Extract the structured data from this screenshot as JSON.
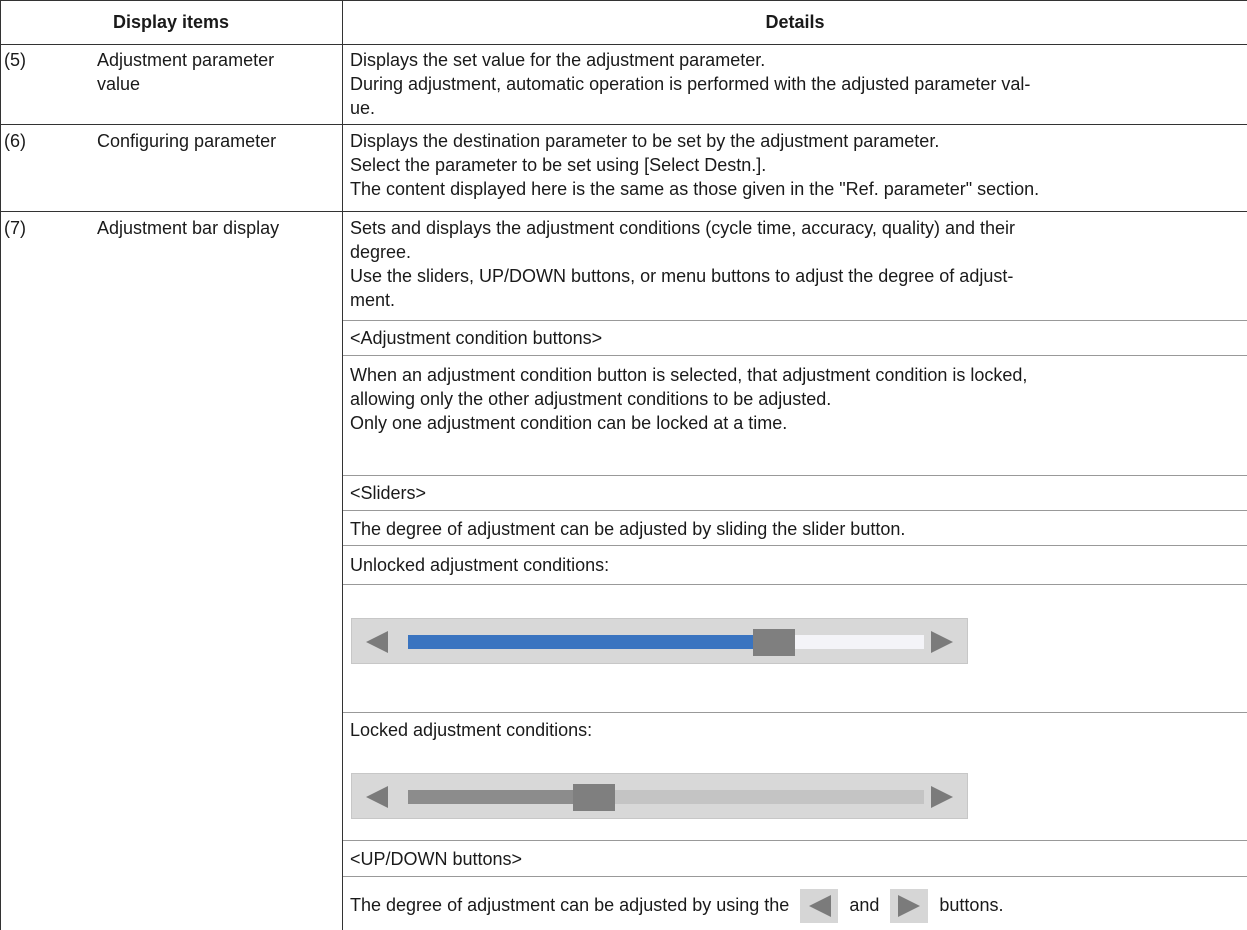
{
  "header": {
    "col1": "Display items",
    "col2": "Details"
  },
  "rows": [
    {
      "num": "(5)",
      "item": [
        "Adjustment parameter",
        "value"
      ],
      "details": [
        "Displays the set value for the adjustment parameter.",
        "During adjustment, automatic operation is performed with the adjusted parameter val-",
        "ue."
      ]
    },
    {
      "num": "(6)",
      "item": [
        "Configuring parameter"
      ],
      "details": [
        "Displays the destination parameter to be set by the adjustment parameter.",
        "Select the parameter to be set using [Select Destn.].",
        "The content displayed here is the same as those given in the \"Ref. parameter\" section."
      ]
    },
    {
      "num": "(7)",
      "item": [
        "Adjustment bar display"
      ],
      "intro": [
        "Sets and displays the adjustment conditions (cycle time, accuracy, quality) and their",
        "degree.",
        "Use the sliders, UP/DOWN buttons, or menu buttons to adjust the degree of adjust-",
        "ment."
      ],
      "cond_heading": "<Adjustment condition buttons>",
      "cond_text": [
        "When an adjustment condition button is selected, that adjustment condition is locked,",
        "allowing only the other adjustment conditions to be adjusted.",
        "Only one adjustment condition can be locked at a time."
      ],
      "sliders_heading": "<Sliders>",
      "sliders_text": "The degree of adjustment can be adjusted by sliding the slider button.",
      "unlocked_label": "Unlocked adjustment conditions:",
      "locked_label": "Locked adjustment conditions:",
      "updown_heading": "<UP/DOWN buttons>",
      "updown_text_pre": "The degree of adjustment can be adjusted by using the",
      "updown_text_mid": "and",
      "updown_text_post": "buttons."
    }
  ],
  "sliders": {
    "unlocked": {
      "level": 0.71,
      "fill_color": "#3a74c0",
      "rest_color": "#f4f4f8"
    },
    "locked": {
      "level": 0.36,
      "fill_color": "#8c8c8c",
      "rest_color": "#c4c4c4"
    }
  }
}
